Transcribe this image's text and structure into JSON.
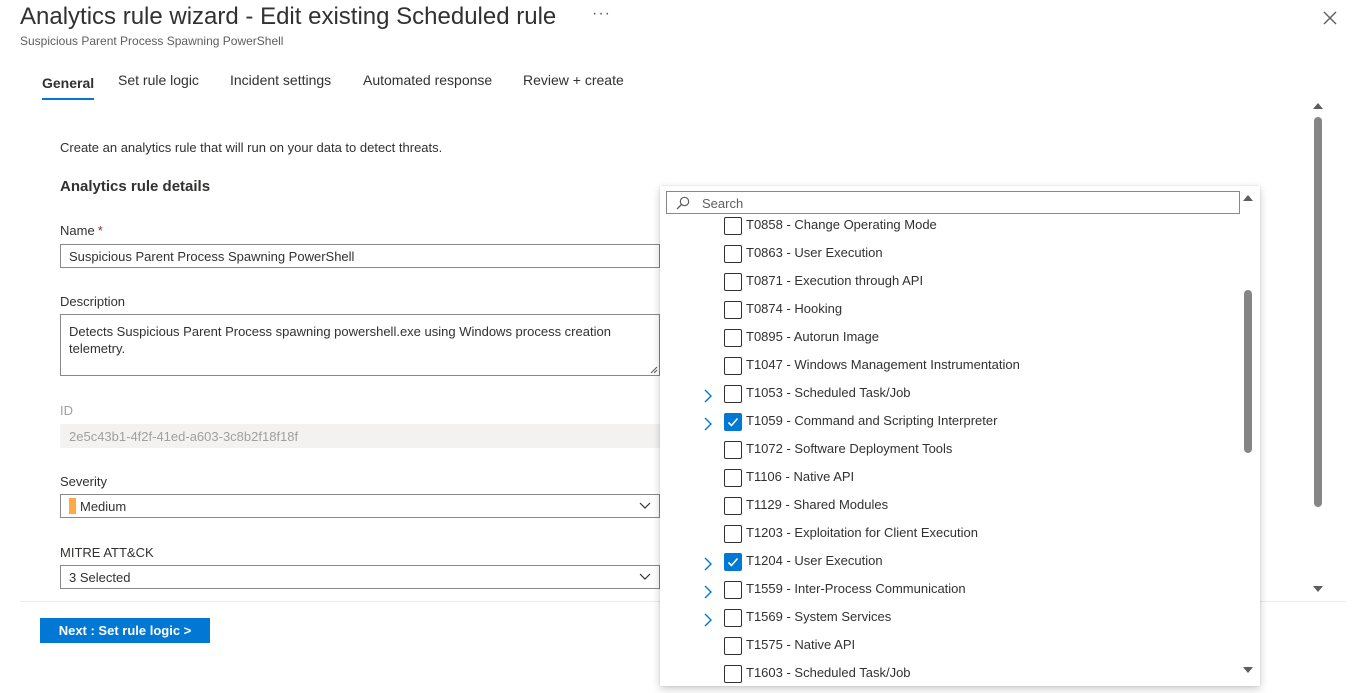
{
  "header": {
    "title": "Analytics rule wizard - Edit existing Scheduled rule",
    "more_label": "···",
    "subtitle": "Suspicious Parent Process Spawning PowerShell",
    "close_icon": "close-icon"
  },
  "tabs": [
    {
      "label": "General",
      "active": true
    },
    {
      "label": "Set rule logic",
      "active": false
    },
    {
      "label": "Incident settings",
      "active": false
    },
    {
      "label": "Automated response",
      "active": false
    },
    {
      "label": "Review + create",
      "active": false
    }
  ],
  "form": {
    "intro": "Create an analytics rule that will run on your data to detect threats.",
    "section_title": "Analytics rule details",
    "name_label": "Name",
    "required_mark": "*",
    "name_value": "Suspicious Parent Process Spawning PowerShell",
    "description_label": "Description",
    "description_value": "Detects Suspicious Parent Process spawning powershell.exe using Windows process creation telemetry.",
    "id_label": "ID",
    "id_value": "2e5c43b1-4f2f-41ed-a603-3c8b2f18f18f",
    "severity_label": "Severity",
    "severity_value": "Medium",
    "severity_color": "#ffaa44",
    "mitre_label": "MITRE ATT&CK",
    "mitre_value": "3 Selected"
  },
  "footer": {
    "next_label": "Next : Set rule logic >"
  },
  "mitre_dropdown": {
    "search_placeholder": "Search",
    "items": [
      {
        "label": "T0858 - Change Operating Mode",
        "checked": false,
        "expandable": false
      },
      {
        "label": "T0863 - User Execution",
        "checked": false,
        "expandable": false
      },
      {
        "label": "T0871 - Execution through API",
        "checked": false,
        "expandable": false
      },
      {
        "label": "T0874 - Hooking",
        "checked": false,
        "expandable": false
      },
      {
        "label": "T0895 - Autorun Image",
        "checked": false,
        "expandable": false
      },
      {
        "label": "T1047 - Windows Management Instrumentation",
        "checked": false,
        "expandable": false
      },
      {
        "label": "T1053 - Scheduled Task/Job",
        "checked": false,
        "expandable": true
      },
      {
        "label": "T1059 - Command and Scripting Interpreter",
        "checked": true,
        "expandable": true
      },
      {
        "label": "T1072 - Software Deployment Tools",
        "checked": false,
        "expandable": false
      },
      {
        "label": "T1106 - Native API",
        "checked": false,
        "expandable": false
      },
      {
        "label": "T1129 - Shared Modules",
        "checked": false,
        "expandable": false
      },
      {
        "label": "T1203 - Exploitation for Client Execution",
        "checked": false,
        "expandable": false
      },
      {
        "label": "T1204 - User Execution",
        "checked": true,
        "expandable": true
      },
      {
        "label": "T1559 - Inter-Process Communication",
        "checked": false,
        "expandable": true
      },
      {
        "label": "T1569 - System Services",
        "checked": false,
        "expandable": true
      },
      {
        "label": "T1575 - Native API",
        "checked": false,
        "expandable": false
      },
      {
        "label": "T1603 - Scheduled Task/Job",
        "checked": false,
        "expandable": false
      }
    ]
  },
  "colors": {
    "accent": "#0078d4",
    "text": "#323130",
    "muted": "#605e5c"
  }
}
